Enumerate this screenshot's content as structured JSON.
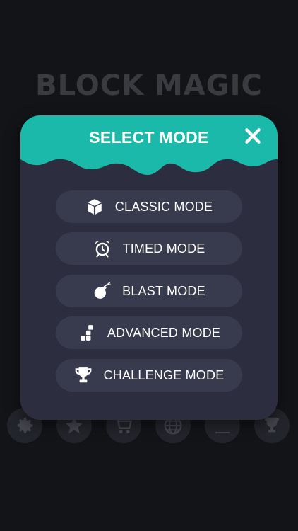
{
  "game": {
    "title": "BLOCK MAGIC"
  },
  "colors": {
    "background": "#131418",
    "modal_body": "#2c2e3f",
    "header_teal": "#1ab9a9",
    "button_bg": "#383b4d",
    "text": "#ffffff"
  },
  "modal": {
    "title": "SELECT MODE",
    "close_icon": "close-icon",
    "modes": [
      {
        "label": "CLASSIC MODE",
        "icon": "cube-icon"
      },
      {
        "label": "TIMED MODE",
        "icon": "alarm-clock-icon"
      },
      {
        "label": "BLAST MODE",
        "icon": "bomb-icon"
      },
      {
        "label": "ADVANCED MODE",
        "icon": "blocks-icon"
      },
      {
        "label": "CHALLENGE MODE",
        "icon": "trophy-icon"
      }
    ]
  },
  "bottom_nav": {
    "items": [
      {
        "icon": "gear-icon"
      },
      {
        "icon": "star-icon"
      },
      {
        "icon": "cart-icon"
      },
      {
        "icon": "globe-icon"
      },
      {
        "icon": "theme-icon"
      },
      {
        "icon": "trophy-icon"
      }
    ]
  }
}
